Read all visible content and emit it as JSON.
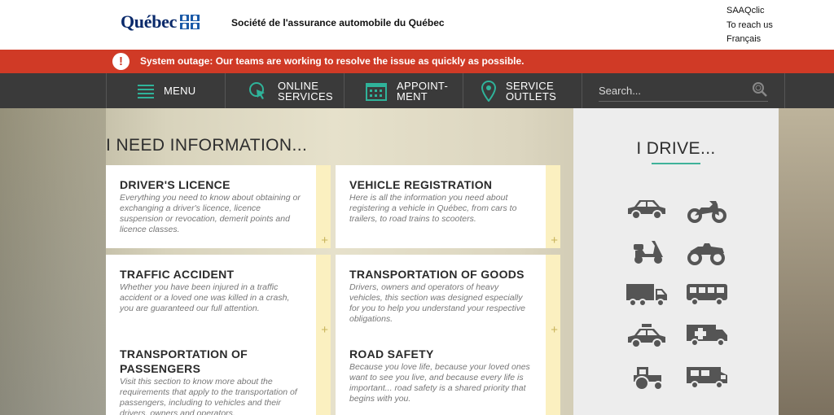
{
  "header": {
    "logo_text": "Québec",
    "org_name": "Société de l'assurance automobile du Québec",
    "links": [
      "SAAQclic",
      "To reach us",
      "Français"
    ]
  },
  "alert": {
    "icon": "exclamation-icon",
    "text": "System outage: Our teams are working to resolve the issue as quickly as possible."
  },
  "nav": {
    "menu": {
      "label": "MENU",
      "icon": "hamburger-icon"
    },
    "online": {
      "line1": "ONLINE",
      "line2": "SERVICES",
      "icon": "cursor-click-icon"
    },
    "appt": {
      "line1": "APPOINT-",
      "line2": "MENT",
      "icon": "calendar-icon"
    },
    "outlets": {
      "line1": "SERVICE",
      "line2": "OUTLETS",
      "icon": "location-pin-icon"
    },
    "search": {
      "placeholder": "Search...",
      "icon": "search-icon"
    }
  },
  "info": {
    "title": "I NEED INFORMATION...",
    "cards": [
      {
        "title": "DRIVER'S LICENCE",
        "desc": "Everything you need to know about obtaining or exchanging a driver's licence, licence suspension or revocation, demerit points and licence classes."
      },
      {
        "title": "VEHICLE REGISTRATION",
        "desc": "Here is all the information you need about registering a vehicle in Québec, from cars to trailers, to road trains to scooters."
      },
      {
        "title": "TRAFFIC ACCIDENT",
        "desc": "Whether you have been injured in a traffic accident or a loved one was killed in a crash, you are guaranteed our full attention."
      },
      {
        "title": "TRANSPORTATION OF GOODS",
        "desc": "Drivers, owners and operators of heavy vehicles, this section was designed especially for you to help you understand your respective obligations."
      },
      {
        "title": "TRANSPORTATION OF PASSENGERS",
        "desc": "Visit this section to know more about the requirements that apply to the transportation of passengers, including to vehicles and their drivers, owners and operators."
      },
      {
        "title": "ROAD SAFETY",
        "desc": "Because you love life, because your loved ones want to see you live, and because every life is important... road safety is a shared priority that begins with you."
      }
    ],
    "plus": "+"
  },
  "drive": {
    "title": "I DRIVE...",
    "vehicles": [
      "car-icon",
      "motorcycle-icon",
      "scooter-icon",
      "atv-icon",
      "truck-icon",
      "bus-icon",
      "taxi-icon",
      "ambulance-icon",
      "tractor-icon",
      "motorhome-icon"
    ]
  },
  "colors": {
    "alert": "#d03a26",
    "nav": "#3a3a3a",
    "accent": "#2fb39a",
    "card_strip": "#fbf0c0"
  }
}
